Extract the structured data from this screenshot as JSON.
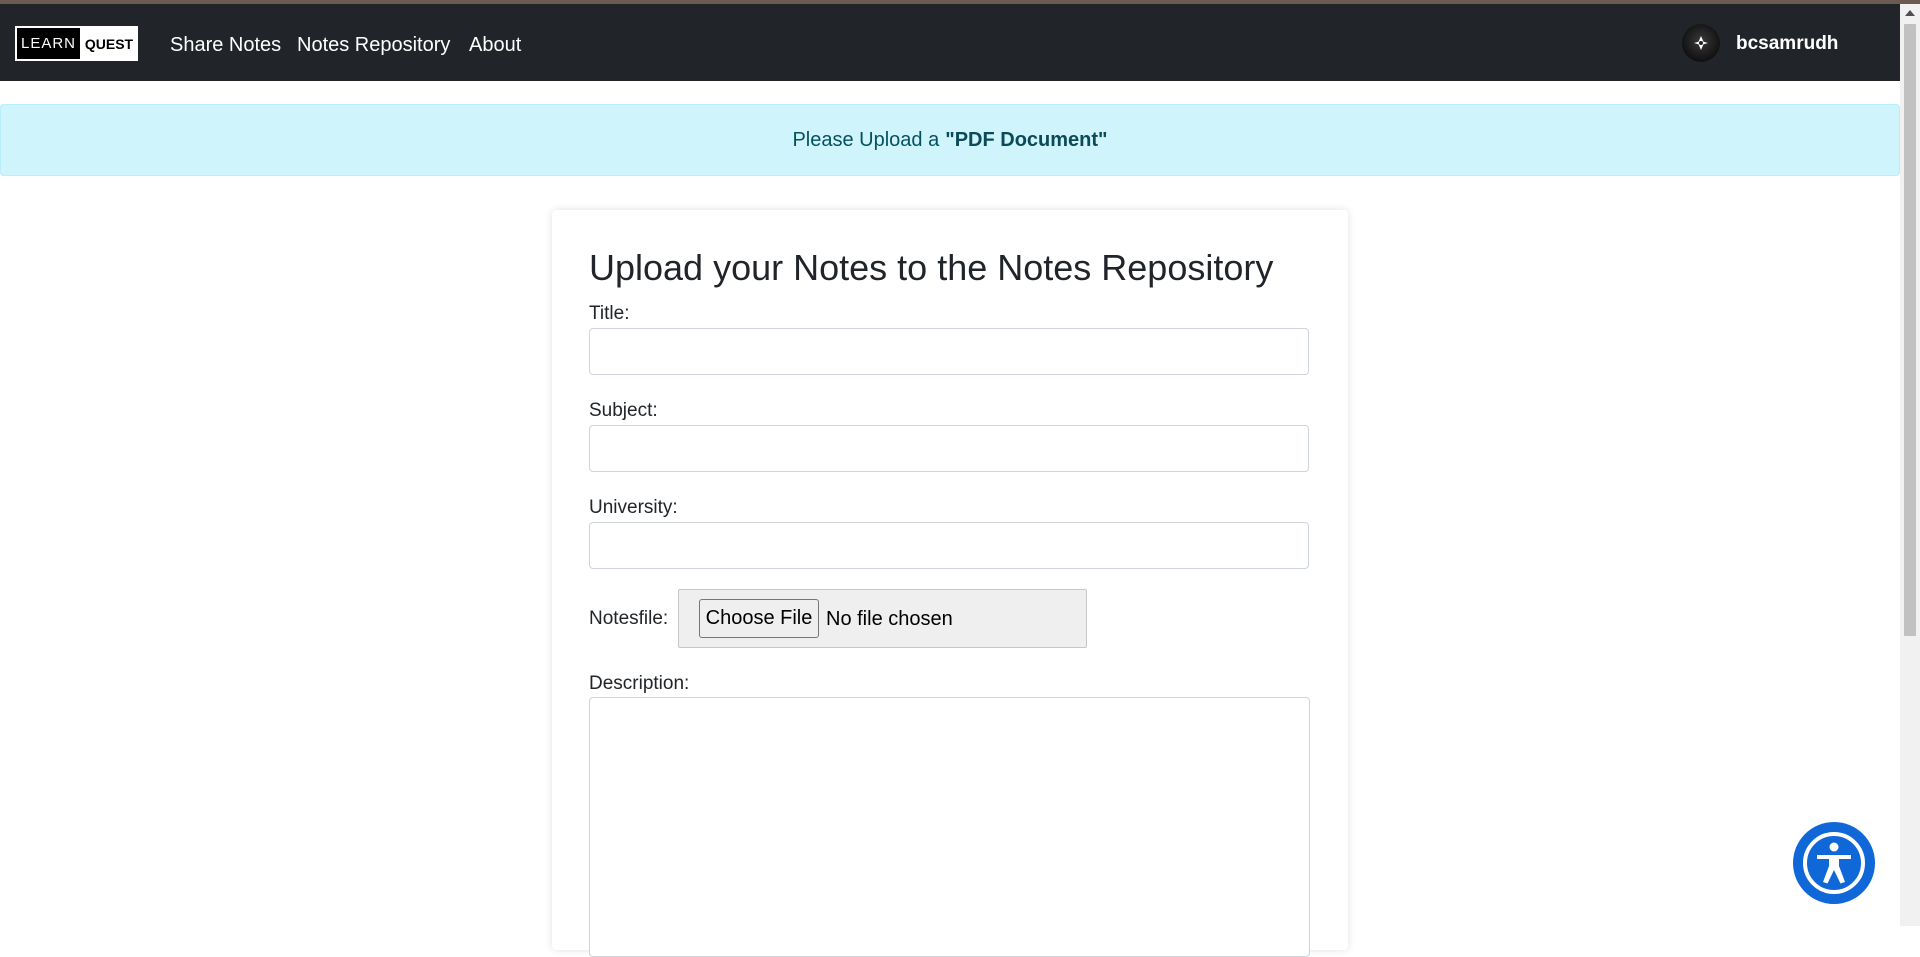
{
  "navbar": {
    "logo": {
      "left": "LEARN",
      "right": "QUEST"
    },
    "links": [
      "Share Notes",
      "Notes Repository",
      "About"
    ],
    "username": "bcsamrudh"
  },
  "alert": {
    "prefix": "Please Upload a",
    "emphasis": "\"PDF Document\""
  },
  "form": {
    "heading": "Upload your Notes to the Notes Repository",
    "title_label": "Title:",
    "subject_label": "Subject:",
    "university_label": "University:",
    "notesfile_label": "Notesfile:",
    "file_button": "Choose File",
    "file_status": "No file chosen",
    "description_label": "Description:",
    "title_value": "",
    "subject_value": "",
    "university_value": ""
  },
  "colors": {
    "navbar": "#212529",
    "alert_bg": "#cff4fc",
    "alert_text": "#055160",
    "accessibility_button": "#1067d8"
  },
  "icons": {
    "avatar": "avatar-icon",
    "accessibility": "accessibility-icon"
  }
}
